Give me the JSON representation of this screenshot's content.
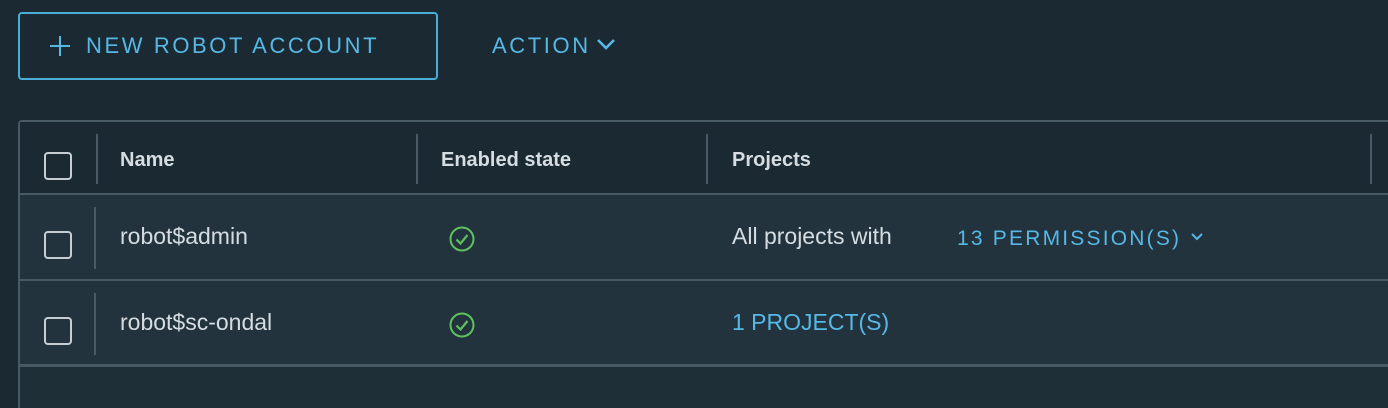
{
  "toolbar": {
    "new_robot_account_label": "NEW ROBOT ACCOUNT",
    "action_label": "ACTION"
  },
  "table": {
    "columns": [
      "Name",
      "Enabled state",
      "Projects"
    ],
    "rows": [
      {
        "name": "robot$admin",
        "enabled": true,
        "projects_text": "All projects with",
        "projects_link": "13 PERMISSION(S)"
      },
      {
        "name": "robot$sc-ondal",
        "enabled": true,
        "projects_text": "",
        "projects_link": "1 PROJECT(S)"
      }
    ]
  },
  "icons": {
    "add": "plus-icon",
    "action_dropdown": "chevron-down-icon",
    "enabled": "check-circle-icon",
    "permissions_dropdown": "chevron-down-icon"
  },
  "colors": {
    "accent": "#57b8e6",
    "success": "#5ec15e",
    "background": "#1b2a32",
    "border": "#485a64"
  }
}
